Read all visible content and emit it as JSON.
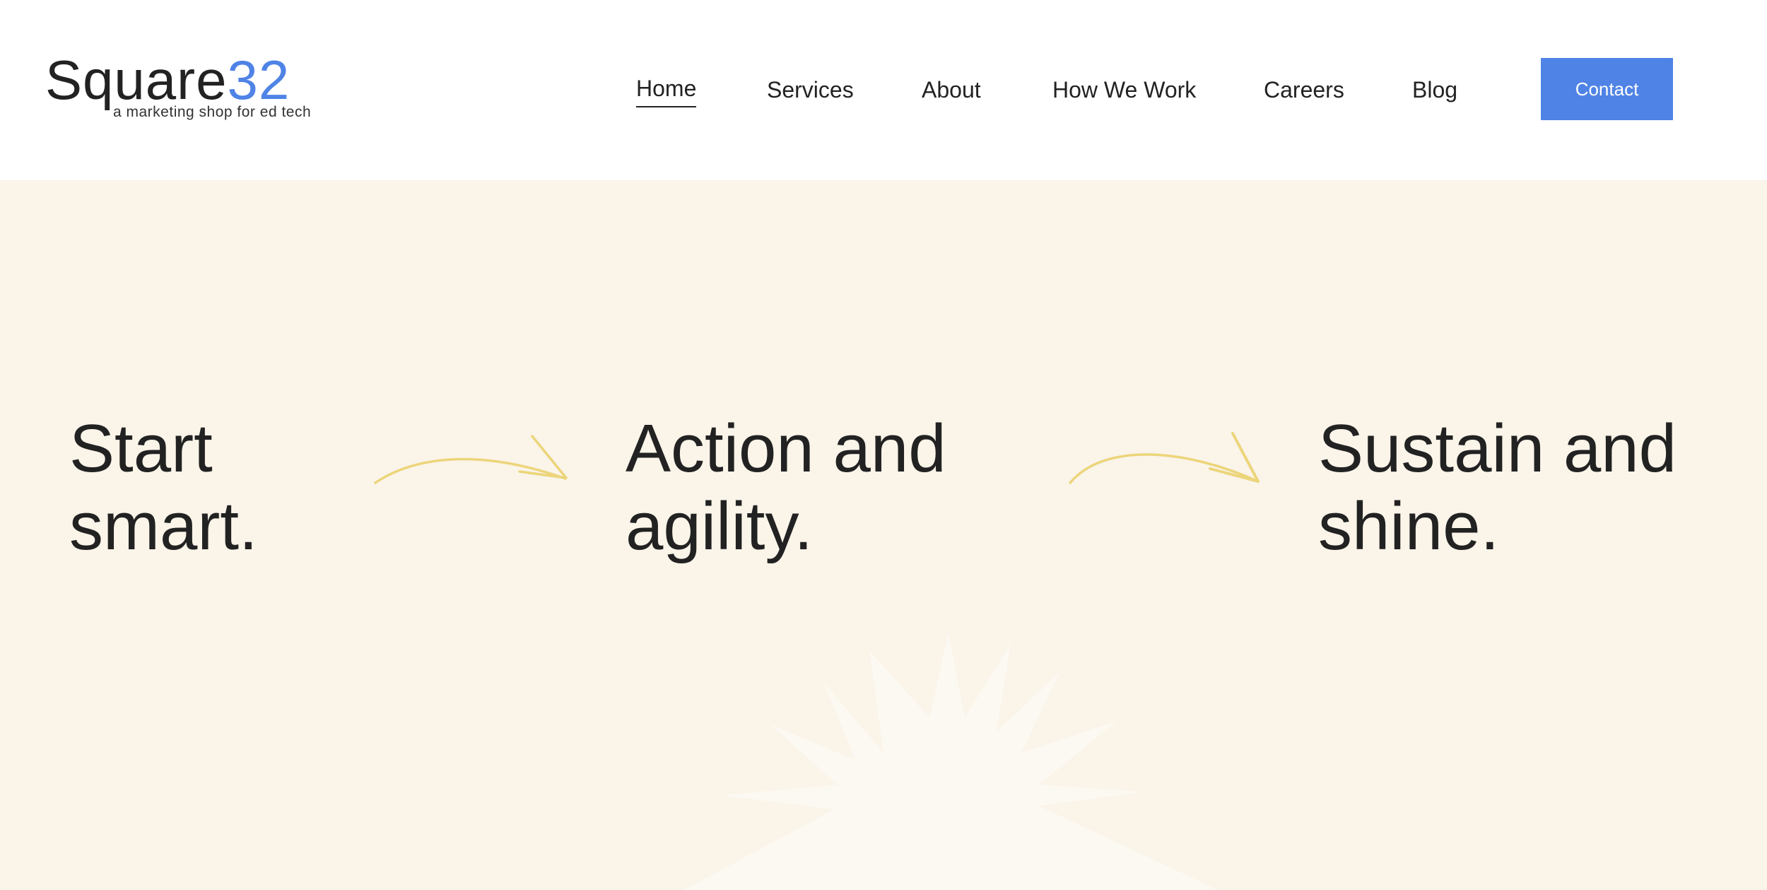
{
  "brand": {
    "name_text": "Square",
    "name_number": "32",
    "tagline": "a marketing shop for ed tech",
    "accent_color": "#4f83e6"
  },
  "nav": {
    "items": [
      {
        "label": "Home",
        "active": true
      },
      {
        "label": "Services",
        "active": false
      },
      {
        "label": "About",
        "active": false
      },
      {
        "label": "How We Work",
        "active": false
      },
      {
        "label": "Careers",
        "active": false
      },
      {
        "label": "Blog",
        "active": false
      }
    ],
    "contact_label": "Contact"
  },
  "hero": {
    "background_color": "#faf4e9",
    "arrow_color": "#ecd57a",
    "steps": [
      {
        "line1": "Start",
        "line2": "smart."
      },
      {
        "line1": "Action and",
        "line2": "agility."
      },
      {
        "line1": "Sustain and",
        "line2": "shine."
      }
    ],
    "decoration": "starburst-icon"
  }
}
